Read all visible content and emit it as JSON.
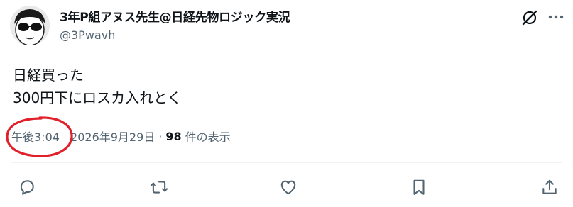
{
  "author": {
    "display_name": "3年P組アヌス先生@日経先物ロジック実況",
    "handle": "@3Pwavh",
    "avatar_icon": "avatar-sunglasses-face"
  },
  "header_actions": {
    "grok_icon": "grok-icon",
    "more_icon": "more-dots-icon"
  },
  "post": {
    "lines": [
      "日経買った",
      "300円下にロスカ入れとく"
    ]
  },
  "meta": {
    "time": "午後3:04",
    "date": "2026年9月29日",
    "separator": "·",
    "views_count": "98",
    "views_label": "件の表示"
  },
  "actions": [
    {
      "name": "reply",
      "icon": "reply-icon"
    },
    {
      "name": "repost",
      "icon": "repost-icon"
    },
    {
      "name": "like",
      "icon": "like-icon"
    },
    {
      "name": "bookmark",
      "icon": "bookmark-icon"
    },
    {
      "name": "share",
      "icon": "share-icon"
    }
  ],
  "colors": {
    "text": "#0f1419",
    "secondary": "#536471",
    "icon": "#536471",
    "annotation": "#e0202a",
    "divider": "#eff3f4"
  }
}
